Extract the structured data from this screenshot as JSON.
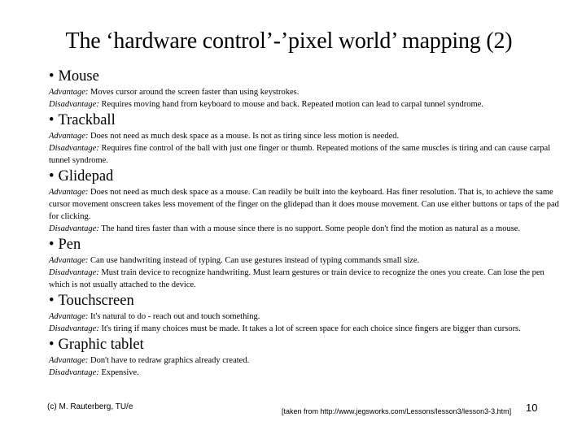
{
  "slide": {
    "title": "The ‘hardware control’-’pixel world’ mapping (2)",
    "bullet_glyph": "•",
    "advantage_label": "Advantage:",
    "disadvantage_label": "Disadvantage:",
    "sections": [
      {
        "heading": "Mouse",
        "advantage": "Moves cursor around the screen faster than using keystrokes.",
        "disadvantage": "Requires moving hand from keyboard to mouse and back. Repeated motion can lead to carpal tunnel syndrome."
      },
      {
        "heading": "Trackball",
        "advantage": "Does not need as much desk space as a mouse. Is not as tiring since less motion is needed.",
        "disadvantage": "Requires fine control of the ball with just one finger or thumb. Repeated motions of the same muscles is tiring and can cause carpal tunnel syndrome."
      },
      {
        "heading": "Glidepad",
        "advantage": "Does not need as much desk space as a mouse. Can readily be built into the keyboard. Has finer resolution. That is, to achieve the same cursor movement onscreen takes less movement of the finger on the glidepad than it does mouse movement. Can use either buttons or taps of the pad for clicking.",
        "disadvantage": "The hand tires faster than with a mouse since there is no support. Some people don't find the motion as natural as a mouse."
      },
      {
        "heading": "Pen",
        "advantage": "Can use handwriting instead of typing. Can use gestures instead of typing commands small size.",
        "disadvantage": "Must train device to recognize handwriting. Must learn gestures or train device to recognize the ones you create. Can lose the pen which is not usually attached to the device."
      },
      {
        "heading": "Touchscreen",
        "advantage": "It's natural to do - reach out and touch something.",
        "disadvantage": "It's tiring if many choices must be made. It takes a lot of screen space for each choice since fingers are bigger than cursors."
      },
      {
        "heading": "Graphic tablet",
        "advantage": "Don't have to redraw graphics already created.",
        "disadvantage": "Expensive."
      }
    ]
  },
  "footer": {
    "copyright": "(c) M. Rauterberg, TU/e",
    "source": "[taken from http://www.jegsworks.com/Lessons/lesson3/lesson3-3.htm]",
    "slide_number": "10"
  }
}
